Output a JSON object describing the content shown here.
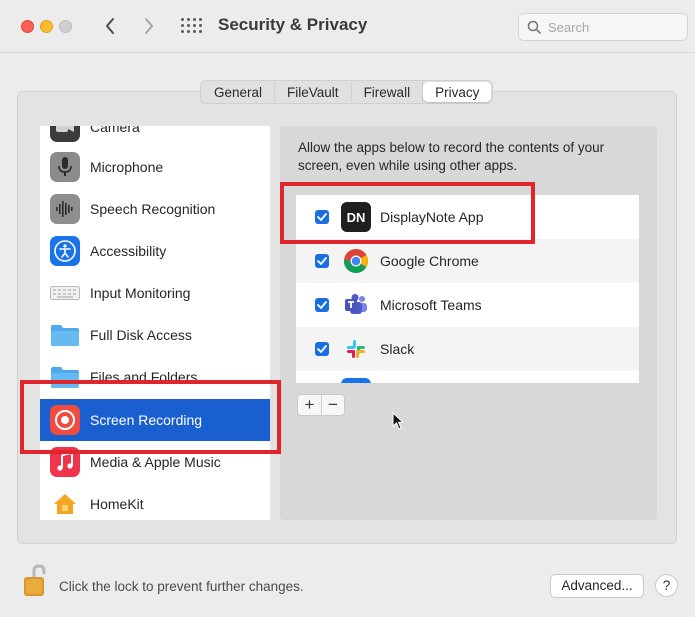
{
  "window": {
    "title": "Security & Privacy",
    "search_placeholder": "Search"
  },
  "tabs": [
    {
      "label": "General",
      "active": false
    },
    {
      "label": "FileVault",
      "active": false
    },
    {
      "label": "Firewall",
      "active": false
    },
    {
      "label": "Privacy",
      "active": true
    }
  ],
  "sidebar": {
    "items": [
      {
        "label": "Camera",
        "icon": "camera-icon"
      },
      {
        "label": "Microphone",
        "icon": "microphone-icon"
      },
      {
        "label": "Speech Recognition",
        "icon": "waveform-icon"
      },
      {
        "label": "Accessibility",
        "icon": "accessibility-icon"
      },
      {
        "label": "Input Monitoring",
        "icon": "keyboard-icon"
      },
      {
        "label": "Full Disk Access",
        "icon": "folder-icon"
      },
      {
        "label": "Files and Folders",
        "icon": "folder-icon"
      },
      {
        "label": "Screen Recording",
        "icon": "screen-recording-icon",
        "selected": true
      },
      {
        "label": "Media & Apple Music",
        "icon": "music-icon"
      },
      {
        "label": "HomeKit",
        "icon": "home-icon"
      }
    ]
  },
  "main": {
    "description": "Allow the apps below to record the contents of your screen, even while using other apps.",
    "apps": [
      {
        "label": "DisplayNote App",
        "checked": true,
        "icon_text": "DN"
      },
      {
        "label": "Google Chrome",
        "checked": true
      },
      {
        "label": "Microsoft Teams",
        "checked": true
      },
      {
        "label": "Slack",
        "checked": true
      }
    ],
    "add_label": "+",
    "remove_label": "−"
  },
  "footer": {
    "lock_text": "Click the lock to prevent further changes.",
    "advanced_label": "Advanced...",
    "help_label": "?"
  },
  "colors": {
    "selection": "#1a5fd0",
    "highlight": "#e0262d",
    "checkbox": "#1a6fe0"
  }
}
